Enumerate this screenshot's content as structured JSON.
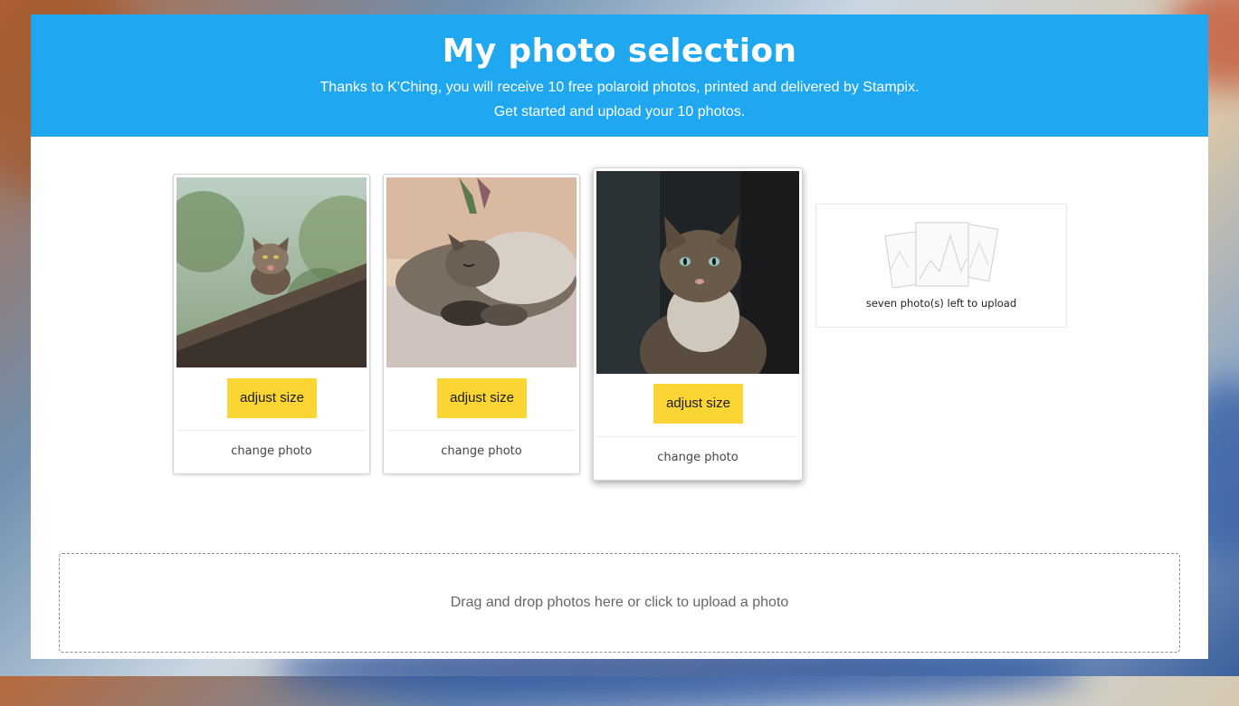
{
  "header": {
    "title": "My photo selection",
    "line1": "Thanks to K'Ching, you will receive 10 free polaroid photos, printed and delivered by Stampix.",
    "line2": "Get started and upload your 10 photos.",
    "background_color": "#1fa8ef"
  },
  "photos": [
    {
      "adjust_label": "adjust size",
      "change_label": "change photo",
      "image": "cat-on-roof-photo"
    },
    {
      "adjust_label": "adjust size",
      "change_label": "change photo",
      "image": "sleeping-cat-photo"
    },
    {
      "adjust_label": "adjust size",
      "change_label": "change photo",
      "image": "tabby-cat-portrait-photo"
    }
  ],
  "remaining": {
    "label": "seven photo(s) left to upload",
    "icon": "photo-stack-icon"
  },
  "dropzone": {
    "label": "Drag and drop photos here or click to upload a photo"
  },
  "colors": {
    "button": "#fad534",
    "accent": "#1fa8ef"
  }
}
